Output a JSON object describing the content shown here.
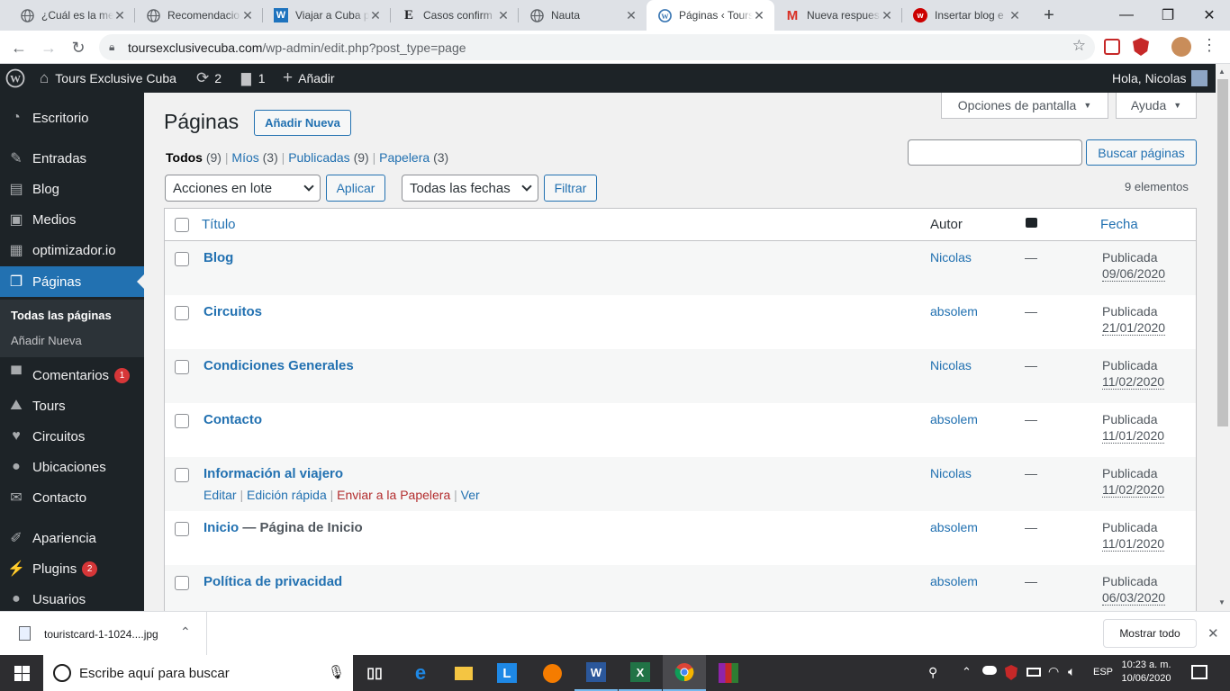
{
  "browser": {
    "tabs": [
      {
        "title": "¿Cuál es la me",
        "icon": "globe-icon"
      },
      {
        "title": "Recomendacio",
        "icon": "globe-icon"
      },
      {
        "title": "Viajar a Cuba p",
        "icon": "w-icon"
      },
      {
        "title": "Casos confirm",
        "icon": "e-icon"
      },
      {
        "title": "Nauta",
        "icon": "globe-icon"
      },
      {
        "title": "Páginas ‹ Tours",
        "icon": "wordpress-icon"
      },
      {
        "title": "Nueva respues",
        "icon": "gmail-icon"
      },
      {
        "title": "Insertar blog e",
        "icon": "w-red-icon"
      }
    ],
    "new_tab": "+",
    "url_host": "toursexclusivecuba.com",
    "url_path": "/wp-admin/edit.php?post_type=page"
  },
  "admin_bar": {
    "site_name": "Tours Exclusive Cuba",
    "updates_count": "2",
    "comments_count": "1",
    "add_label": "Añadir",
    "greeting": "Hola, Nicolas"
  },
  "menu": {
    "items": [
      {
        "label": "Escritorio",
        "icon": "dashboard-icon"
      },
      {
        "label": "Entradas",
        "icon": "pin-icon"
      },
      {
        "label": "Blog",
        "icon": "blog-icon"
      },
      {
        "label": "Medios",
        "icon": "media-icon"
      },
      {
        "label": "optimizador.io",
        "icon": "optimizer-icon"
      },
      {
        "label": "Páginas",
        "icon": "pages-icon"
      },
      {
        "label": "Comentarios",
        "icon": "comments-icon",
        "badge": "1"
      },
      {
        "label": "Tours",
        "icon": "tours-icon"
      },
      {
        "label": "Circuitos",
        "icon": "heart-icon"
      },
      {
        "label": "Ubicaciones",
        "icon": "location-icon"
      },
      {
        "label": "Contacto",
        "icon": "mail-icon"
      },
      {
        "label": "Apariencia",
        "icon": "brush-icon"
      },
      {
        "label": "Plugins",
        "icon": "plugins-icon",
        "badge": "2"
      },
      {
        "label": "Usuarios",
        "icon": "users-icon"
      }
    ],
    "submenu": {
      "all": "Todas las páginas",
      "add": "Añadir Nueva"
    }
  },
  "page": {
    "title": "Páginas",
    "add_new": "Añadir Nueva",
    "screen_options": "Opciones de pantalla",
    "help": "Ayuda",
    "filters": [
      {
        "label": "Todos",
        "count": "(9)"
      },
      {
        "label": "Míos",
        "count": "(3)"
      },
      {
        "label": "Publicadas",
        "count": "(9)"
      },
      {
        "label": "Papelera",
        "count": "(3)"
      }
    ],
    "search_button": "Buscar páginas",
    "search_value": "",
    "bulk_actions": "Acciones en lote",
    "apply": "Aplicar",
    "all_dates": "Todas las fechas",
    "filter": "Filtrar",
    "items_count": "9 elementos",
    "columns": {
      "title": "Título",
      "author": "Autor",
      "date": "Fecha"
    },
    "rows": [
      {
        "title": "Blog",
        "state": "",
        "author": "Nicolas",
        "comments": "—",
        "status": "Publicada",
        "date": "09/06/2020"
      },
      {
        "title": "Circuitos",
        "state": "",
        "author": "absolem",
        "comments": "—",
        "status": "Publicada",
        "date": "21/01/2020"
      },
      {
        "title": "Condiciones Generales",
        "state": "",
        "author": "Nicolas",
        "comments": "—",
        "status": "Publicada",
        "date": "11/02/2020"
      },
      {
        "title": "Contacto",
        "state": "",
        "author": "absolem",
        "comments": "—",
        "status": "Publicada",
        "date": "11/01/2020"
      },
      {
        "title": "Información al viajero",
        "state": "",
        "author": "Nicolas",
        "comments": "—",
        "status": "Publicada",
        "date": "11/02/2020"
      },
      {
        "title": "Inicio",
        "state": " — Página de Inicio",
        "author": "absolem",
        "comments": "—",
        "status": "Publicada",
        "date": "11/01/2020"
      },
      {
        "title": "Política de privacidad",
        "state": "",
        "author": "absolem",
        "comments": "—",
        "status": "Publicada",
        "date": "06/03/2020"
      }
    ],
    "row_actions": {
      "edit": "Editar",
      "quick": "Edición rápida",
      "trash": "Enviar a la Papelera",
      "view": "Ver"
    }
  },
  "downloads": {
    "file": "touristcard-1-1024....jpg",
    "show_all": "Mostrar todo"
  },
  "taskbar": {
    "search_placeholder": "Escribe aquí para buscar",
    "lang": "ESP",
    "time": "10:23 a. m.",
    "date": "10/06/2020"
  },
  "colors": {
    "wp_blue": "#2271b1",
    "admin_dark": "#1d2327",
    "badge_red": "#d63638"
  }
}
